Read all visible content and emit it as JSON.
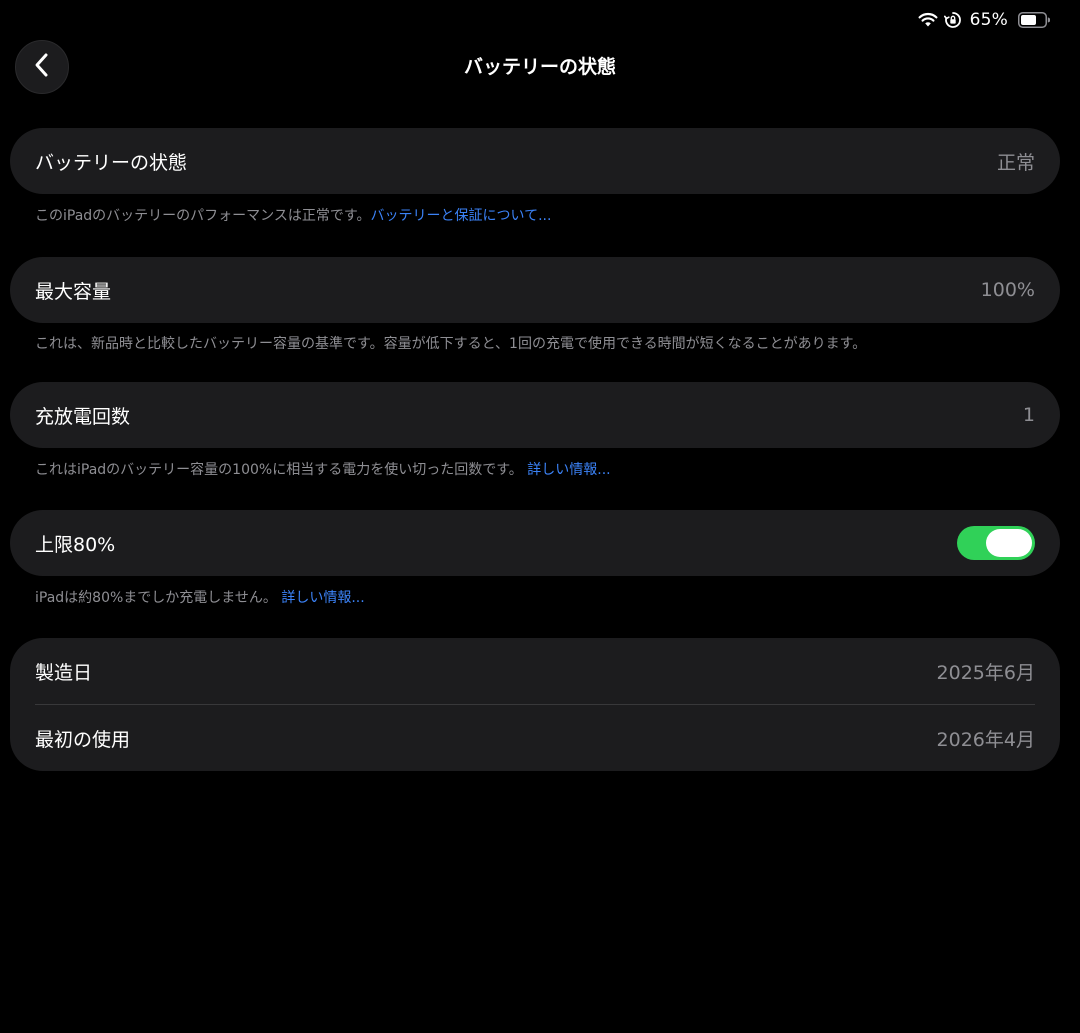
{
  "status_bar": {
    "battery_percent": "65%",
    "battery_level": 0.65,
    "icons": [
      "wifi-icon",
      "orientation-lock-icon",
      "battery-icon"
    ]
  },
  "nav": {
    "back_icon": "chevron-left-icon",
    "title": "バッテリーの状態"
  },
  "battery_health": {
    "label": "バッテリーの状態",
    "value": "正常",
    "footnote": "このiPadのバッテリーのパフォーマンスは正常です。",
    "footnote_link": "バッテリーと保証について..."
  },
  "max_capacity": {
    "label": "最大容量",
    "value": "100%",
    "footnote": "これは、新品時と比較したバッテリー容量の基準です。容量が低下すると、1回の充電で使用できる時間が短くなることがあります。"
  },
  "cycle_count": {
    "label": "充放電回数",
    "value": "1",
    "footnote": "これはiPadのバッテリー容量の100%に相当する電力を使い切った回数です。",
    "footnote_link": "詳しい情報..."
  },
  "limit": {
    "label": "上限80%",
    "toggle_on": true,
    "footnote": "iPadは約80%までしか充電しません。",
    "footnote_link": "詳しい情報..."
  },
  "dates": {
    "manufacture_label": "製造日",
    "manufacture_value": "2025年6月",
    "first_use_label": "最初の使用",
    "first_use_value": "2026年4月"
  },
  "colors": {
    "background": "#000000",
    "card": "#1c1c1e",
    "secondary_text": "#8e8e93",
    "link": "#3b82f6",
    "toggle_on": "#30d158"
  }
}
